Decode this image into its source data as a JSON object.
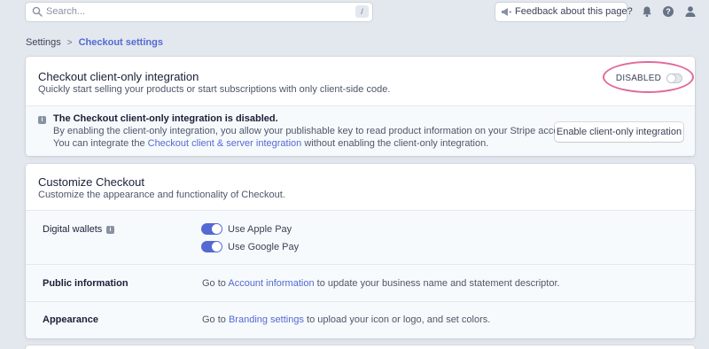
{
  "search": {
    "placeholder": "Search...",
    "shortcut": "/"
  },
  "header": {
    "feedback_label": "Feedback about this page?"
  },
  "breadcrumb": {
    "parent": "Settings",
    "separator": ">",
    "current": "Checkout settings"
  },
  "client_only": {
    "title": "Checkout client-only integration",
    "subtitle": "Quickly start selling your products or start subscriptions with only client-side code.",
    "status_label": "DISABLED",
    "notice": {
      "badge": "i",
      "title": "The Checkout client-only integration is disabled.",
      "line1": "By enabling the client-only integration, you allow your publishable key to read product information on your Stripe account.",
      "line2_before": "You can integrate the ",
      "line2_link": "Checkout client & server integration",
      "line2_after": " without enabling the client-only integration.",
      "enable_button": "Enable client-only integration"
    }
  },
  "customize": {
    "title": "Customize Checkout",
    "subtitle": "Customize the appearance and functionality of Checkout.",
    "rows": {
      "wallets": {
        "label": "Digital wallets",
        "badge": "i",
        "options": [
          {
            "label": "Use Apple Pay",
            "enabled": true
          },
          {
            "label": "Use Google Pay",
            "enabled": true
          }
        ]
      },
      "public_info": {
        "label": "Public information",
        "before": "Go to ",
        "link": "Account information",
        "after": " to update your business name and statement descriptor."
      },
      "appearance": {
        "label": "Appearance",
        "before": "Go to ",
        "link": "Branding settings",
        "after": " to upload your icon or logo, and set colors."
      }
    }
  },
  "colors": {
    "accent": "#5469d4",
    "background": "#e3e8ee",
    "highlight": "#e06a9a"
  }
}
